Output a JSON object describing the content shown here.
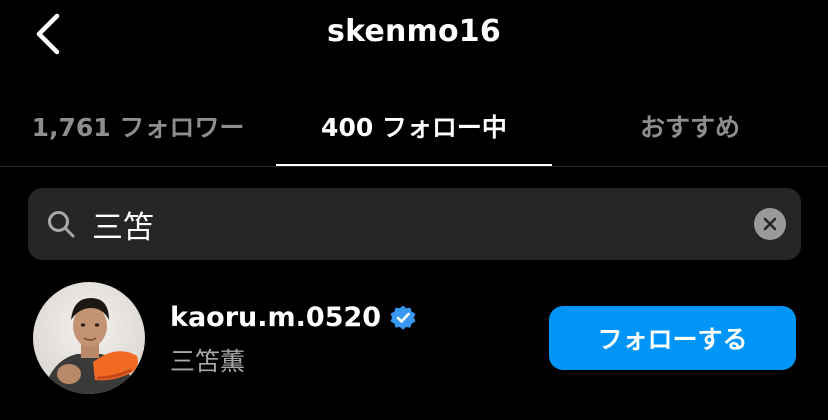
{
  "header": {
    "back_icon": "chevron-left-icon",
    "title": "skenmo16"
  },
  "tabs": [
    {
      "label": "1,761 フォロワー",
      "active": false
    },
    {
      "label": "400 フォロー中",
      "active": true
    },
    {
      "label": "おすすめ",
      "active": false
    }
  ],
  "search": {
    "icon": "search-icon",
    "value": "三笘",
    "clear_icon": "clear-icon"
  },
  "results": [
    {
      "username": "kaoru.m.0520",
      "verified": true,
      "full_name": "三笘薫",
      "action_label": "フォローする"
    }
  ],
  "colors": {
    "background": "#000000",
    "inactive_text": "#8e8e8e",
    "search_bg": "#262626",
    "primary_button": "#0095f6",
    "verified_badge": "#3897f0"
  }
}
